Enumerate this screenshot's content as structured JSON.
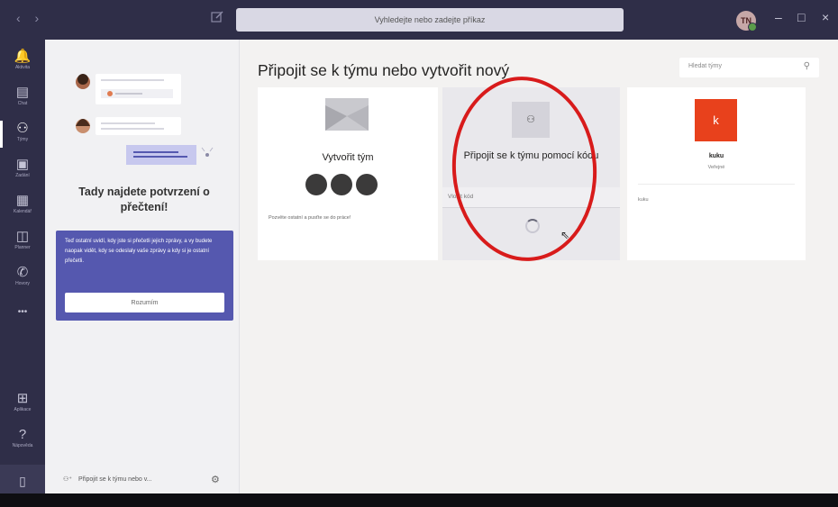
{
  "window": {
    "search_placeholder": "Vyhledejte nebo zadejte příkaz",
    "avatar_initials": "TN",
    "controls": [
      "–",
      "□",
      "×"
    ]
  },
  "rail": {
    "items": [
      {
        "label": "Aktivita",
        "icon": "bell-icon",
        "glyph": "🔔"
      },
      {
        "label": "Chat",
        "icon": "chat-icon",
        "glyph": "▤"
      },
      {
        "label": "Týmy",
        "icon": "teams-icon",
        "glyph": "⚇"
      },
      {
        "label": "Zadání",
        "icon": "assignments-icon",
        "glyph": "▣"
      },
      {
        "label": "Kalendář",
        "icon": "calendar-icon",
        "glyph": "▦"
      },
      {
        "label": "Planner",
        "icon": "planner-icon",
        "glyph": "◫"
      },
      {
        "label": "Hovory",
        "icon": "phone-icon",
        "glyph": "✆"
      },
      {
        "label": "",
        "icon": "more-icon",
        "glyph": "•••"
      }
    ],
    "bottom_items": [
      {
        "label": "Aplikace",
        "icon": "apps-icon",
        "glyph": "⊞"
      },
      {
        "label": "Nápověda",
        "icon": "help-icon",
        "glyph": "?"
      }
    ],
    "device_icon": "▯"
  },
  "left_panel": {
    "title": "Tady najdete potvrzení o přečtení!",
    "callout_text": "Teď ostatní uvidí, kdy jste si přečetli jejich zprávy, a vy budete naopak vidět, kdy se odeslaly vaše zprávy a kdy si je ostatní přečetli.",
    "callout_button": "Rozumím",
    "footer_label": "Připojit se k týmu nebo v..."
  },
  "main": {
    "title": "Připojit se k týmu nebo vytvořit nový",
    "search_placeholder": "Hledat týmy",
    "cards": {
      "create": {
        "title": "Vytvořit tým",
        "description": "Pozvěte ostatní a pusťte se do práce!"
      },
      "join": {
        "title": "Připojit se k týmu pomocí kódu",
        "field_placeholder": "Vložit kód"
      },
      "team": {
        "avatar_letter": "k",
        "name": "kuku",
        "type": "Veřejné",
        "description": "kuku"
      }
    }
  },
  "colors": {
    "rail": "#2f2e48",
    "accent": "#5558af",
    "team_avatar": "#e8411c",
    "highlight": "#d81b1b"
  }
}
